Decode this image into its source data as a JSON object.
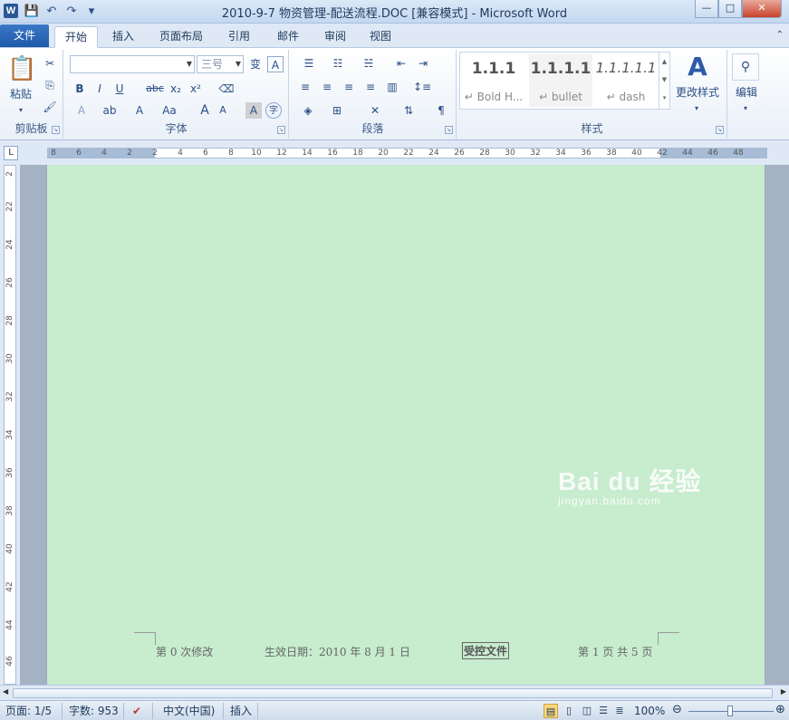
{
  "app": {
    "title": "2010-9-7 物资管理-配送流程.DOC [兼容模式]  -  Microsoft Word",
    "logo_letter": "W"
  },
  "window_buttons": {
    "minimize": "—",
    "maximize": "□",
    "close": "✕"
  },
  "tabs": [
    {
      "label": "文件"
    },
    {
      "label": "开始"
    },
    {
      "label": "插入"
    },
    {
      "label": "页面布局"
    },
    {
      "label": "引用"
    },
    {
      "label": "邮件"
    },
    {
      "label": "审阅"
    },
    {
      "label": "视图"
    }
  ],
  "ribbon": {
    "clipboard": {
      "label": "剪贴板",
      "paste": "粘贴"
    },
    "font": {
      "label": "字体",
      "font_name": "",
      "font_size": "三号",
      "wen": "变",
      "bold": "B",
      "italic": "I",
      "underline": "U",
      "strike": "abc",
      "sub": "x₂",
      "sup": "x²",
      "grow": "A",
      "shrink": "A",
      "aa": "Aa",
      "char_shade": "A",
      "enclose": "字"
    },
    "paragraph": {
      "label": "段落"
    },
    "styles": {
      "label": "样式",
      "items": [
        {
          "preview": "1.1.1",
          "name": "↵ Bold H..."
        },
        {
          "preview": "1.1.1.1",
          "name": "↵ bullet"
        },
        {
          "preview": "1.1.1.1.1",
          "name": "↵ dash"
        }
      ],
      "change_styles": "更改样式"
    },
    "editing": {
      "label": "编辑"
    }
  },
  "hruler": {
    "numbers": [
      "8",
      "6",
      "4",
      "2",
      "2",
      "4",
      "6",
      "8",
      "10",
      "12",
      "14",
      "16",
      "18",
      "20",
      "22",
      "24",
      "26",
      "28",
      "30",
      "32",
      "34",
      "36",
      "38",
      "40",
      "42",
      "44",
      "46",
      "48"
    ]
  },
  "vruler": {
    "numbers": [
      "2",
      "22",
      "24",
      "26",
      "28",
      "30",
      "32",
      "34",
      "36",
      "38",
      "40",
      "42",
      "44",
      "46"
    ]
  },
  "document": {
    "footer": {
      "revision": "第 0 次修改",
      "effective": "生效日期：2010 年 8 月 1 日",
      "controlled": "受控文件",
      "page": "第 1 页 共 5 页"
    },
    "watermark": {
      "brand": "Bai du 经验",
      "site": "jingyan.baidu.com"
    }
  },
  "status": {
    "page": "页面: 1/5",
    "words": "字数: 953",
    "lang": "中文(中国)",
    "mode": "插入",
    "zoom": "100%"
  },
  "colors": {
    "page_bg": "#c7ecce",
    "file_tab": "#2b63b4",
    "frame": "#dfe9f5"
  }
}
